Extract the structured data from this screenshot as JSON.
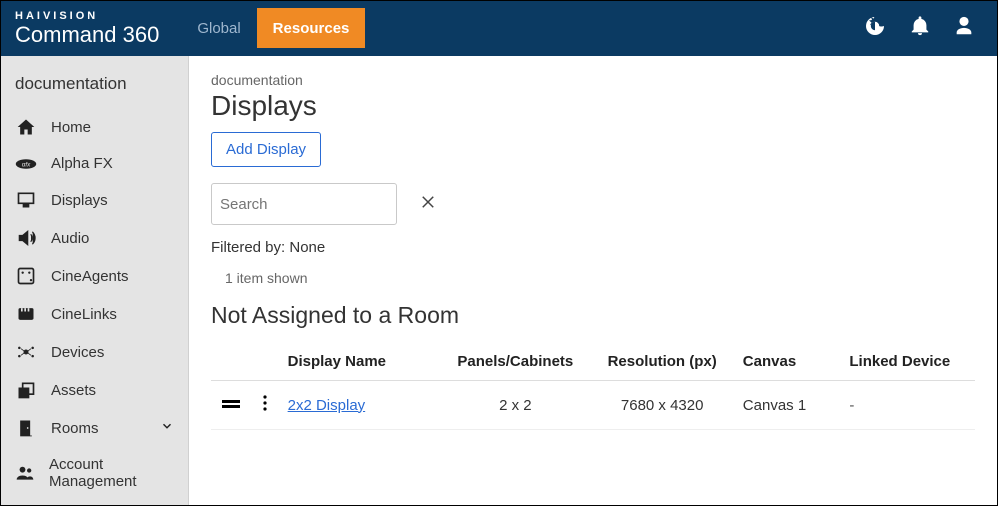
{
  "brand": {
    "top": "HAIVISION",
    "bottom": "Command 360"
  },
  "nav": {
    "global": "Global",
    "resources": "Resources"
  },
  "sidebar": {
    "title": "documentation",
    "items": [
      {
        "label": "Home"
      },
      {
        "label": "Alpha FX"
      },
      {
        "label": "Displays"
      },
      {
        "label": "Audio"
      },
      {
        "label": "CineAgents"
      },
      {
        "label": "CineLinks"
      },
      {
        "label": "Devices"
      },
      {
        "label": "Assets"
      },
      {
        "label": "Rooms"
      },
      {
        "label": "Account Management"
      }
    ]
  },
  "main": {
    "crumb": "documentation",
    "title": "Displays",
    "add_button": "Add Display",
    "search_placeholder": "Search",
    "filtered_by": "Filtered by: None",
    "item_shown": "1 item shown",
    "section": "Not Assigned to a Room",
    "columns": {
      "name": "Display Name",
      "panels": "Panels/Cabinets",
      "resolution": "Resolution (px)",
      "canvas": "Canvas",
      "linked": "Linked Device"
    },
    "rows": [
      {
        "name": "2x2 Display",
        "panels": "2 x 2",
        "resolution": "7680 x 4320",
        "canvas": "Canvas 1",
        "linked": "-"
      }
    ]
  }
}
